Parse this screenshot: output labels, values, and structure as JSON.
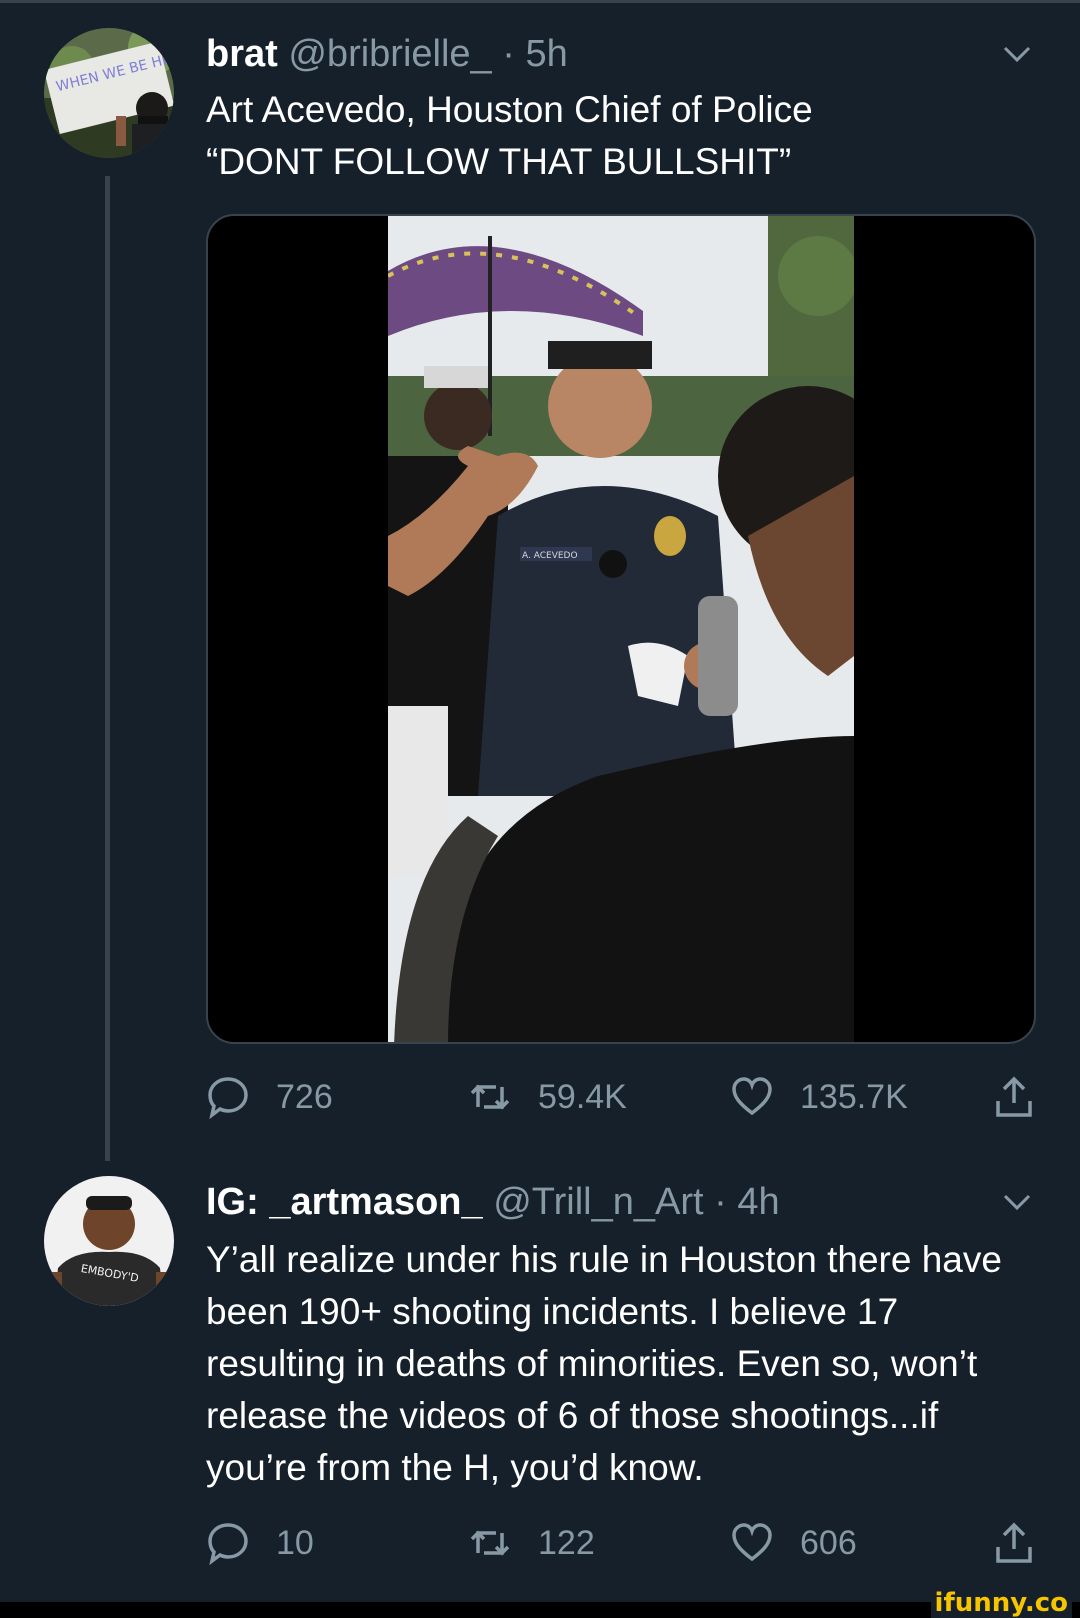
{
  "tweets": [
    {
      "name": "brat",
      "handle": "@bribrielle_",
      "separator": "·",
      "time": "5h",
      "text_line1": "Art Acevedo, Houston Chief of Police",
      "text_line2": "“DONT FOLLOW THAT BULLSHIT”",
      "avatar_sign_text": "WHEN WE BE HEARD",
      "photo_badge_text": "A. ACEVEDO",
      "replies": "726",
      "retweets": "59.4K",
      "likes": "135.7K"
    },
    {
      "name": "IG: _artmason_",
      "handle": "@Trill_n_Art",
      "separator": "·",
      "time": "4h",
      "text": "Y’all realize under his rule in Houston there have been 190+ shooting incidents. I believe 17 resulting in deaths of minorities. Even so, won’t release the videos of 6 of those shootings...if you’re from the H, you’d know.",
      "avatar_shirt_text": "EMBODY'D",
      "replies": "10",
      "retweets": "122",
      "likes": "606"
    }
  ],
  "watermark": "ifunny.co",
  "icons": [
    "reply-icon",
    "retweet-icon",
    "like-icon",
    "share-icon",
    "chevron-down-icon"
  ],
  "colors": {
    "background": "#15202b",
    "secondary_text": "#8899a6",
    "divider": "#38444d",
    "watermark": "#f7c400"
  }
}
